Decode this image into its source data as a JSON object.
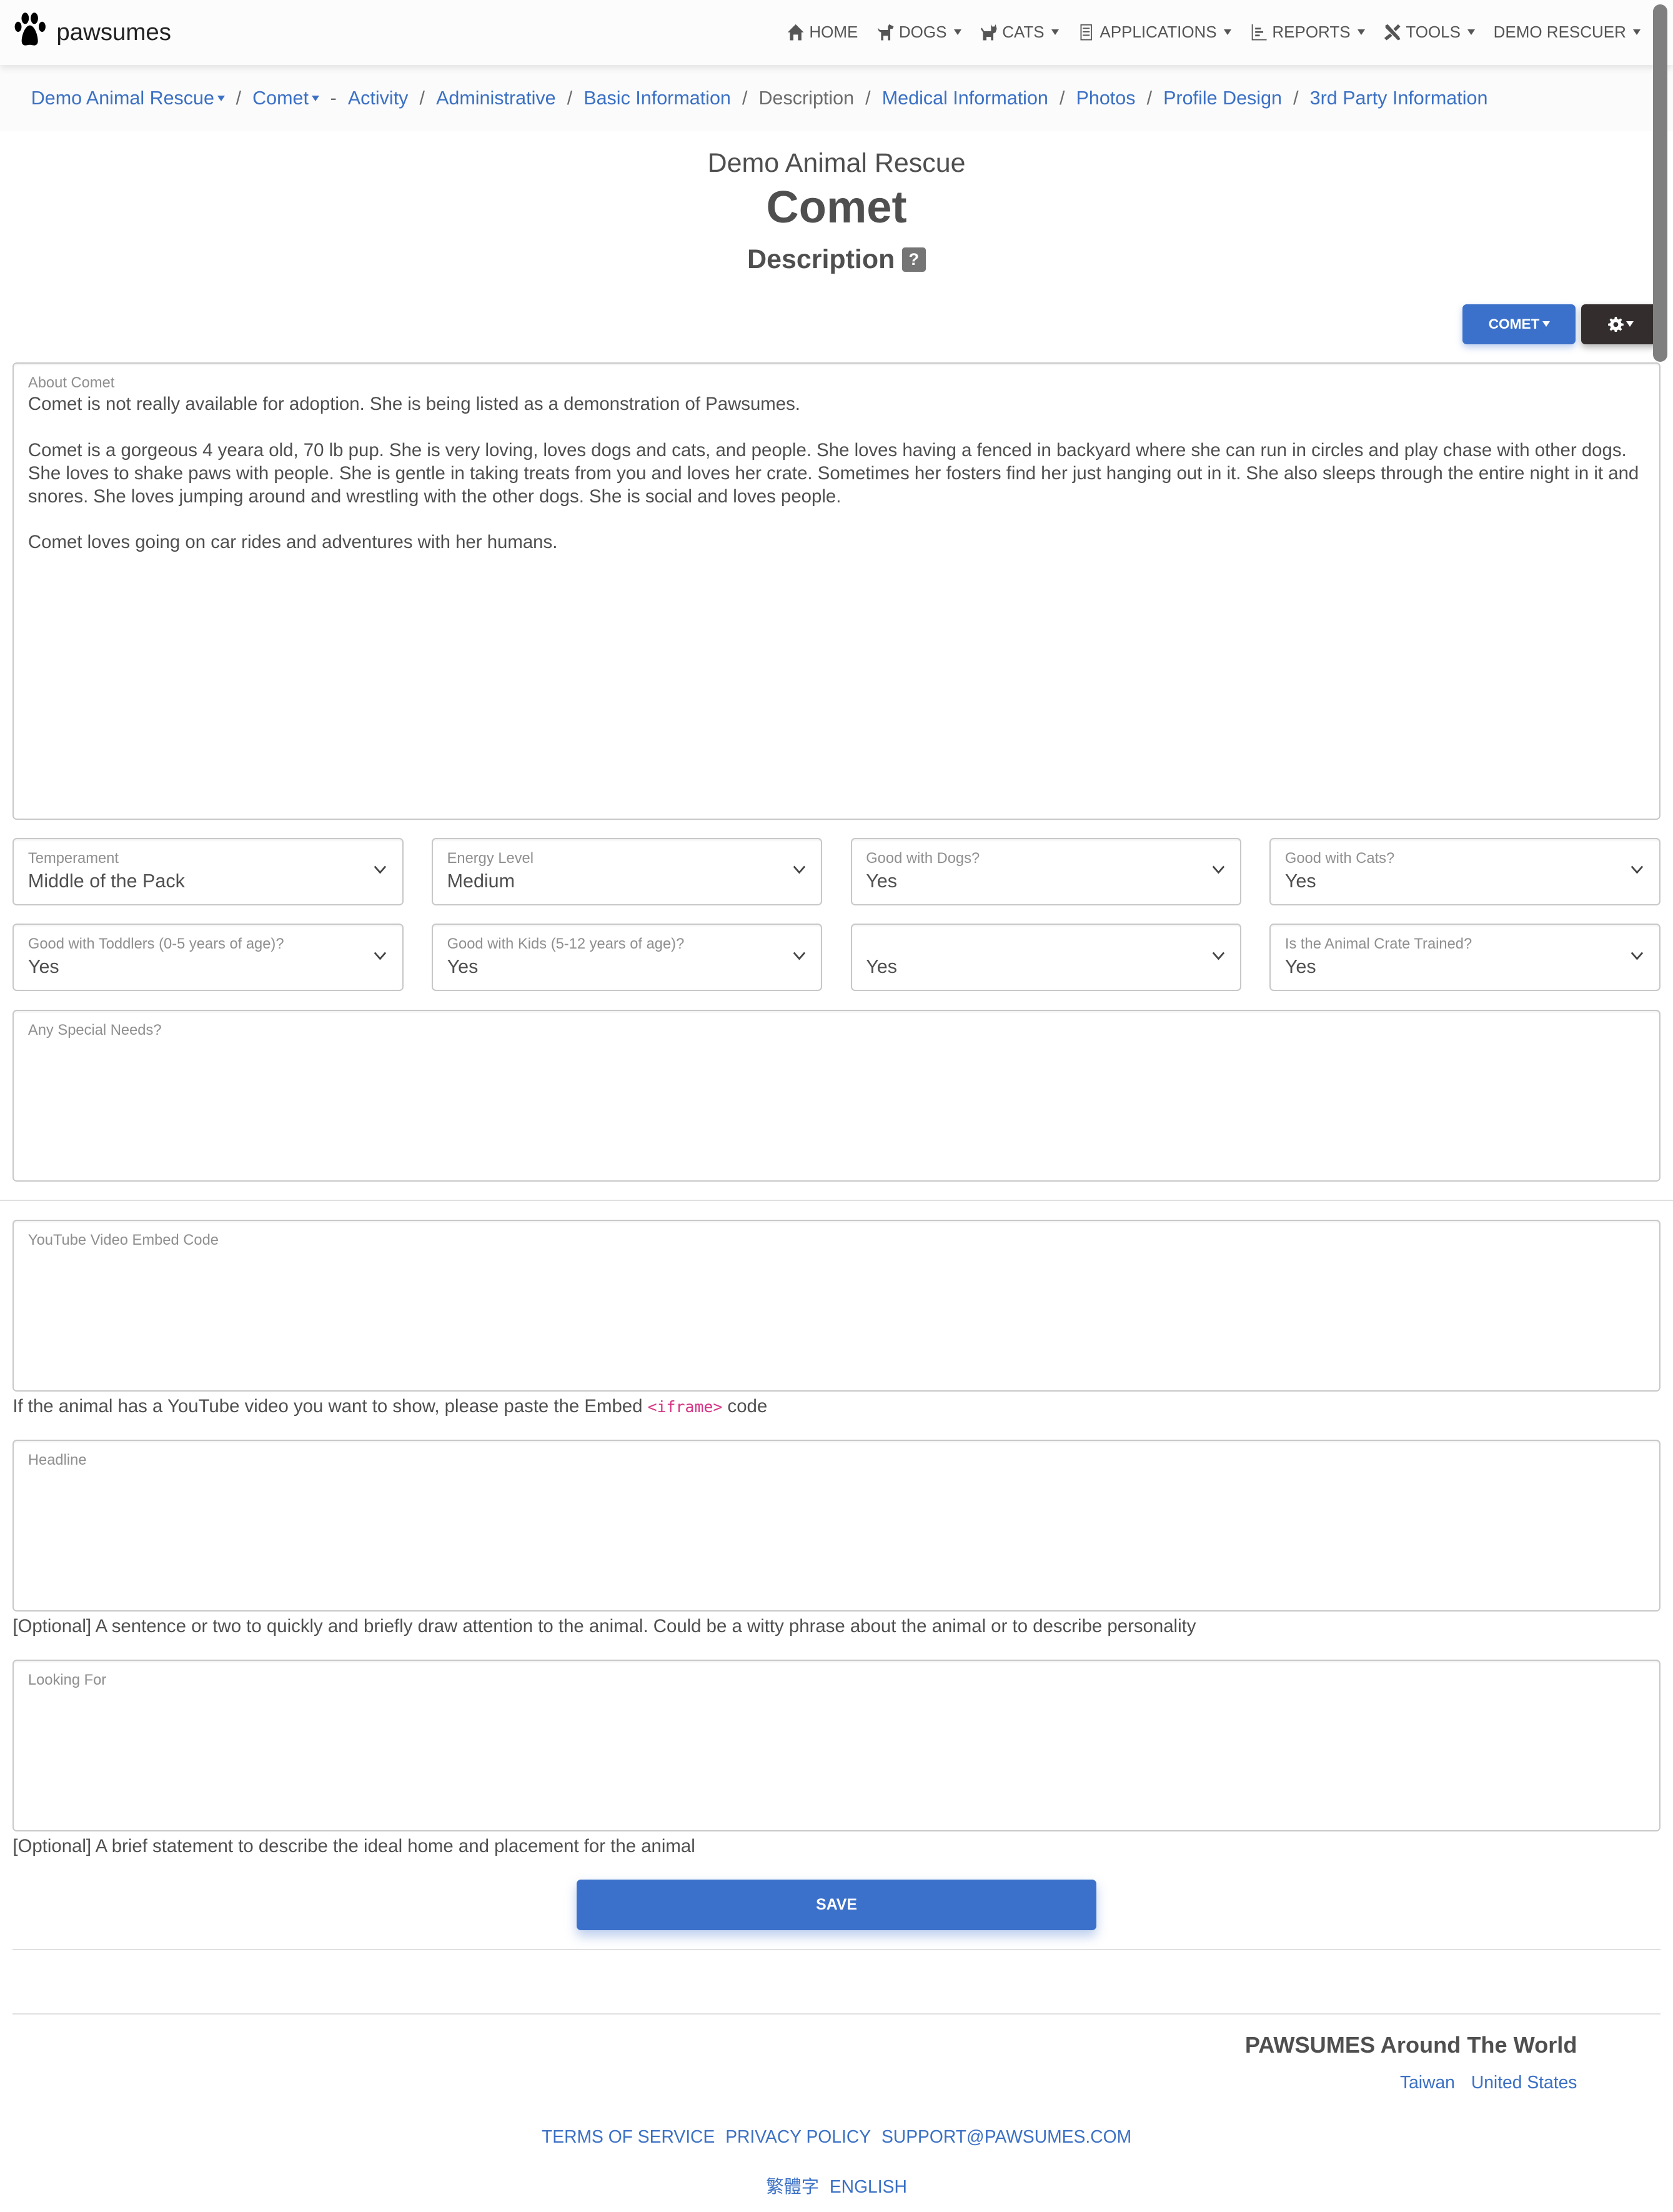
{
  "brand": {
    "name": "pawsumes",
    "icon": "paw-icon"
  },
  "nav": [
    {
      "label": "HOME",
      "icon": "home-icon",
      "dropdown": false
    },
    {
      "label": "DOGS",
      "icon": "dog-icon",
      "dropdown": true
    },
    {
      "label": "CATS",
      "icon": "cat-icon",
      "dropdown": true
    },
    {
      "label": "APPLICATIONS",
      "icon": "clipboard-icon",
      "dropdown": true
    },
    {
      "label": "REPORTS",
      "icon": "chart-icon",
      "dropdown": true
    },
    {
      "label": "TOOLS",
      "icon": "tools-icon",
      "dropdown": true
    },
    {
      "label": "DEMO RESCUER",
      "icon": "",
      "dropdown": true
    }
  ],
  "breadcrumb": {
    "org": "Demo Animal Rescue",
    "animal": "Comet",
    "dash": "-",
    "items": [
      {
        "label": "Activity",
        "active": false
      },
      {
        "label": "Administrative",
        "active": false
      },
      {
        "label": "Basic Information",
        "active": false
      },
      {
        "label": "Description",
        "active": true
      },
      {
        "label": "Medical Information",
        "active": false
      },
      {
        "label": "Photos",
        "active": false
      },
      {
        "label": "Profile Design",
        "active": false
      },
      {
        "label": "3rd Party Information",
        "active": false
      }
    ],
    "separator": "/"
  },
  "header": {
    "org": "Demo Animal Rescue",
    "animal": "Comet",
    "section": "Description",
    "help": "?"
  },
  "actions": {
    "animal_button": "COMET",
    "settings_icon": "gear-icon"
  },
  "form": {
    "about": {
      "label": "About Comet",
      "value": "Comet is not really available for adoption. She is being listed as a demonstration of Pawsumes.\n\nComet is a gorgeous 4 yeara old, 70 lb pup. She is very loving, loves dogs and cats, and people. She loves having a fenced in backyard where she can run in circles and play chase with other dogs. She loves to shake paws with people. She is gentle in taking treats from you and loves her crate. Sometimes her fosters find her just hanging out in it. She also sleeps through the entire night in it and snores. She loves jumping around and wrestling with the other dogs. She is social and loves people.\n\nComet loves going on car rides and adventures with her humans."
    },
    "selects": [
      {
        "label": "Temperament",
        "value": "Middle of the Pack"
      },
      {
        "label": "Energy Level",
        "value": "Medium"
      },
      {
        "label": "Good with Dogs?",
        "value": "Yes"
      },
      {
        "label": "Good with Cats?",
        "value": "Yes"
      },
      {
        "label": "Good with Toddlers (0-5 years of age)?",
        "value": "Yes"
      },
      {
        "label": "Good with Kids (5-12 years of age)?",
        "value": "Yes"
      },
      {
        "label": "",
        "value": "Yes"
      },
      {
        "label": "Is the Animal Crate Trained?",
        "value": "Yes"
      }
    ],
    "special_needs": {
      "label": "Any Special Needs?",
      "value": ""
    },
    "youtube": {
      "label": "YouTube Video Embed Code",
      "value": "",
      "help_before": "If the animal has a YouTube video you want to show, please paste the Embed ",
      "help_code": "<iframe>",
      "help_after": " code"
    },
    "headline": {
      "label": "Headline",
      "value": "",
      "help": "[Optional] A sentence or two to quickly and briefly draw attention to the animal. Could be a witty phrase about the animal or to describe personality"
    },
    "looking_for": {
      "label": "Looking For",
      "value": "",
      "help": "[Optional] A brief statement to describe the ideal home and placement for the animal"
    },
    "save_label": "SAVE"
  },
  "footer": {
    "world_title": "PAWSUMES Around The World",
    "countries": [
      "Taiwan",
      "United States"
    ],
    "links": [
      "TERMS OF SERVICE",
      "PRIVACY POLICY",
      "SUPPORT@PAWSUMES.COM"
    ],
    "languages": [
      "繁體字",
      "ENGLISH"
    ]
  },
  "colors": {
    "primary": "#3b71ca",
    "dark": "#332d2d",
    "link": "#3b70c4",
    "code": "#d63384",
    "text": "#4f4f4f"
  }
}
